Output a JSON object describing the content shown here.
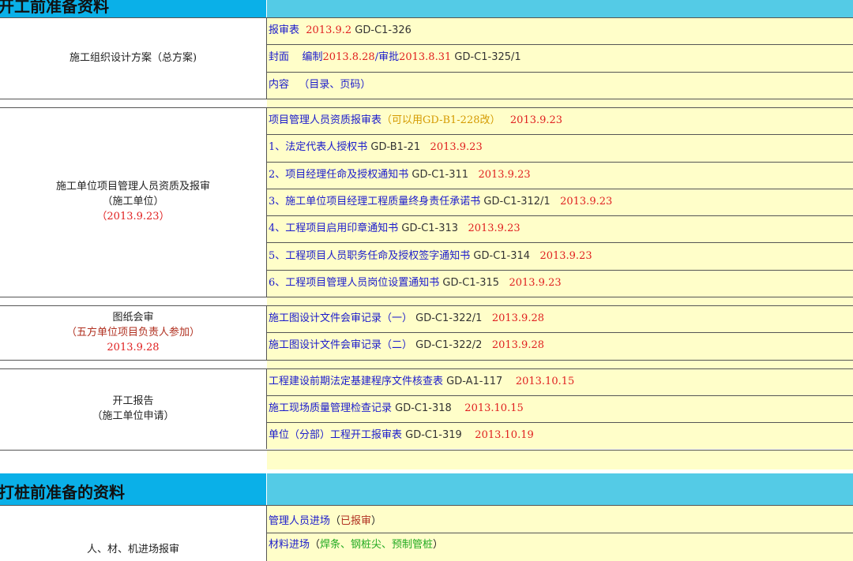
{
  "section1": {
    "title": "开工前准备资料",
    "groups": [
      {
        "label_lines": [
          {
            "text": "施工组织设计方案（总方案)",
            "color": "#222222"
          }
        ],
        "items": [
          {
            "parts": [
              [
                "报审表",
                "blue"
              ],
              [
                "  2013.9.2",
                "red"
              ],
              [
                " GD-C1-326",
                "dark"
              ]
            ]
          },
          {
            "parts": [
              [
                "封面    编制",
                "blue"
              ],
              [
                "2013.8.28",
                "red"
              ],
              [
                "/审批",
                "blue"
              ],
              [
                "2013.8.31",
                "red"
              ],
              [
                " GD-C1-325/1",
                "dark"
              ]
            ]
          },
          {
            "parts": [
              [
                "内容   （目录、页码）",
                "blue"
              ]
            ]
          }
        ]
      },
      {
        "label_lines": [
          {
            "text": "施工单位项目管理人员资质及报审",
            "color": "#222222"
          },
          {
            "text": "（施工单位）",
            "color": "#222222"
          },
          {
            "text": "（2013.9.23）",
            "color": "#e02020"
          }
        ],
        "items": [
          {
            "parts": [
              [
                "项目管理人员资质报审表",
                "blue"
              ],
              [
                "（可以用GD-B1-228改）",
                "gold"
              ],
              [
                "   2013.9.23",
                "red"
              ]
            ]
          },
          {
            "parts": [
              [
                "1、法定代表人授权书",
                "blue"
              ],
              [
                " GD-B1-21",
                "dark"
              ],
              [
                "   2013.9.23",
                "red"
              ]
            ]
          },
          {
            "parts": [
              [
                "2、项目经理任命及授权通知书",
                "blue"
              ],
              [
                " GD-C1-311",
                "dark"
              ],
              [
                "   2013.9.23",
                "red"
              ]
            ]
          },
          {
            "parts": [
              [
                "3、施工单位项目经理工程质量终身责任承诺书",
                "blue"
              ],
              [
                " GD-C1-312/1",
                "dark"
              ],
              [
                "   2013.9.23",
                "red"
              ]
            ]
          },
          {
            "parts": [
              [
                "4、工程项目启用印章通知书",
                "blue"
              ],
              [
                " GD-C1-313",
                "dark"
              ],
              [
                "   2013.9.23",
                "red"
              ]
            ]
          },
          {
            "parts": [
              [
                "5、工程项目人员职务任命及授权签字通知书",
                "blue"
              ],
              [
                " GD-C1-314",
                "dark"
              ],
              [
                "   2013.9.23",
                "red"
              ]
            ]
          },
          {
            "parts": [
              [
                "6、工程项目管理人员岗位设置通知书",
                "blue"
              ],
              [
                " GD-C1-315",
                "dark"
              ],
              [
                "   2013.9.23",
                "red"
              ]
            ]
          }
        ]
      },
      {
        "label_lines": [
          {
            "text": "图纸会审",
            "color": "#222222"
          },
          {
            "text": "（五方单位项目负责人参加）",
            "color": "#b03020"
          },
          {
            "text": "2013.9.28",
            "color": "#e02020"
          }
        ],
        "items": [
          {
            "parts": [
              [
                "施工图设计文件会审记录（一）",
                "blue"
              ],
              [
                " GD-C1-322/1",
                "dark"
              ],
              [
                "   2013.9.28",
                "red"
              ]
            ]
          },
          {
            "parts": [
              [
                "施工图设计文件会审记录（二）",
                "blue"
              ],
              [
                " GD-C1-322/2",
                "dark"
              ],
              [
                "   2013.9.28",
                "red"
              ]
            ]
          }
        ]
      },
      {
        "label_lines": [
          {
            "text": "开工报告",
            "color": "#222222"
          },
          {
            "text": "（施工单位申请）",
            "color": "#222222"
          }
        ],
        "items": [
          {
            "parts": [
              [
                "工程建设前期法定基建程序文件核查表",
                "blue"
              ],
              [
                " GD-A1-117",
                "dark"
              ],
              [
                "    2013.10.15",
                "red"
              ]
            ]
          },
          {
            "parts": [
              [
                "施工现场质量管理检查记录",
                "blue"
              ],
              [
                " GD-C1-318",
                "dark"
              ],
              [
                "    2013.10.15",
                "red"
              ]
            ]
          },
          {
            "parts": [
              [
                "单位（分部）工程开工报审表",
                "blue"
              ],
              [
                " GD-C1-319",
                "dark"
              ],
              [
                "    2013.10.19",
                "red"
              ]
            ]
          }
        ]
      }
    ]
  },
  "section2": {
    "title": "打桩前准备的资料",
    "group": {
      "label_lines": [
        {
          "text": "人、材、机进场报审",
          "color": "#222222"
        }
      ],
      "items": [
        {
          "parts": [
            [
              "管理人员进场",
              "blue"
            ],
            [
              "（",
              "black"
            ],
            [
              "已报审",
              "brown"
            ],
            [
              "）",
              "black"
            ]
          ]
        },
        {
          "parts": [
            [
              "材料进场",
              "blue"
            ],
            [
              "（",
              "black"
            ],
            [
              "焊条、钢桩尖、预制管桩",
              "green"
            ],
            [
              "）",
              "black"
            ]
          ]
        }
      ]
    }
  },
  "colors": {
    "header_left": "#0ab0e8",
    "header_right": "#54cbe6",
    "content_bg": "#fffec9",
    "label_blue": "#1b1bcc",
    "date_red": "#e02020",
    "code_gray": "#333333",
    "note_gold": "#d49a00",
    "note_green": "#22aa22"
  }
}
